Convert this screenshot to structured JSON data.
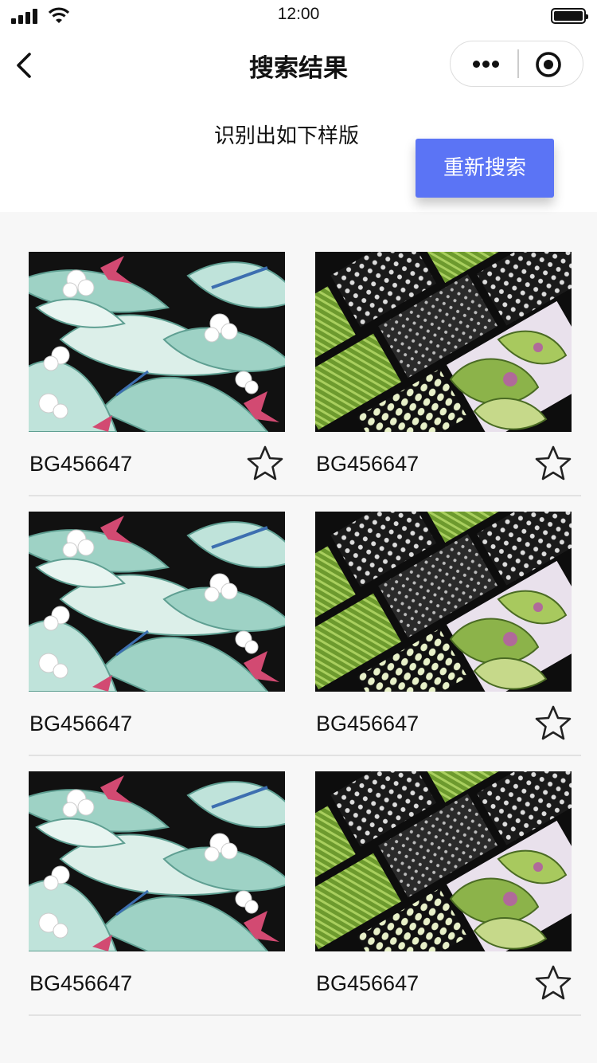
{
  "status_bar": {
    "time": "12:00"
  },
  "nav": {
    "title": "搜索结果"
  },
  "header": {
    "subtitle": "识别出如下样版",
    "research_label": "重新搜索"
  },
  "colors": {
    "accent": "#5b74f5"
  },
  "results": [
    {
      "code": "BG456647",
      "pattern": "tropical-leaves",
      "favorite_icon": true
    },
    {
      "code": "BG456647",
      "pattern": "patchwork-paisley",
      "favorite_icon": true
    },
    {
      "code": "BG456647",
      "pattern": "tropical-leaves",
      "favorite_icon": false
    },
    {
      "code": "BG456647",
      "pattern": "patchwork-paisley",
      "favorite_icon": true
    },
    {
      "code": "BG456647",
      "pattern": "tropical-leaves",
      "favorite_icon": false
    },
    {
      "code": "BG456647",
      "pattern": "patchwork-paisley",
      "favorite_icon": true
    }
  ]
}
